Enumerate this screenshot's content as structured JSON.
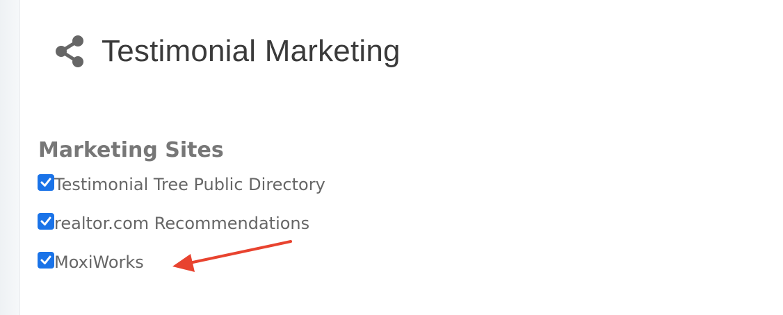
{
  "header": {
    "title": "Testimonial Marketing",
    "icon": "share-icon"
  },
  "marketing_sites": {
    "heading": "Marketing Sites",
    "items": [
      {
        "label": "Testimonial Tree Public Directory",
        "checked": true
      },
      {
        "label": "realtor.com Recommendations",
        "checked": true
      },
      {
        "label": "MoxiWorks",
        "checked": true
      }
    ]
  },
  "annotation": {
    "arrow_color": "#e8432f",
    "points_to": "MoxiWorks"
  },
  "colors": {
    "checkbox": "#1a73e8",
    "title_text": "#3a3a3a",
    "heading_text": "#777777",
    "label_text": "#666666",
    "icon": "#666666"
  }
}
